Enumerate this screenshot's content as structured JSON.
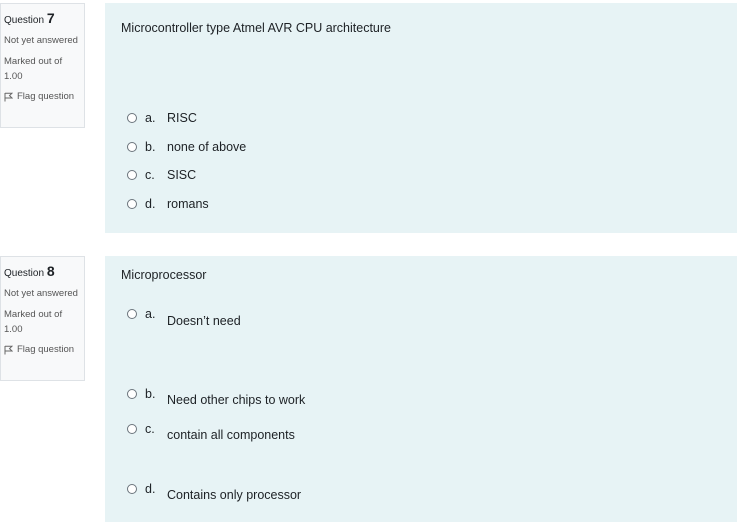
{
  "questions": [
    {
      "label": "Question",
      "number": "7",
      "state": "Not yet answered",
      "marked": "Marked out of 1.00",
      "flag": "Flag question",
      "text": "Microcontroller type Atmel AVR CPU architecture",
      "options": [
        {
          "letter": "a.",
          "text": "RISC"
        },
        {
          "letter": "b.",
          "text": "none of above"
        },
        {
          "letter": "c.",
          "text": "SISC"
        },
        {
          "letter": "d.",
          "text": "romans"
        }
      ]
    },
    {
      "label": "Question",
      "number": "8",
      "state": "Not yet answered",
      "marked": "Marked out of 1.00",
      "flag": "Flag question",
      "text": "Microprocessor",
      "options": [
        {
          "letter": "a.",
          "text": "Doesn’t need"
        },
        {
          "letter": "b.",
          "text": "Need other chips to work"
        },
        {
          "letter": "c.",
          "text": "contain all components"
        },
        {
          "letter": "d.",
          "text": "Contains only processor"
        }
      ]
    }
  ]
}
